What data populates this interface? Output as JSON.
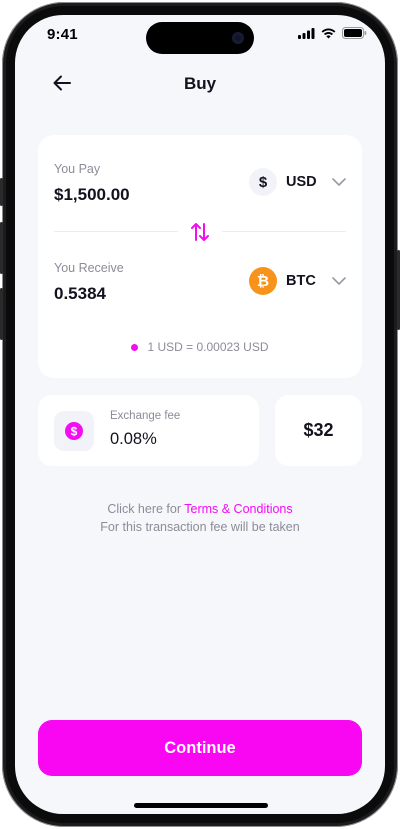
{
  "status_bar": {
    "time": "9:41"
  },
  "header": {
    "title": "Buy"
  },
  "exchange": {
    "pay": {
      "label": "You Pay",
      "amount": "$1,500.00",
      "currency_code": "USD",
      "currency_symbol": "$"
    },
    "receive": {
      "label": "You Receive",
      "amount": "0.5384",
      "currency_code": "BTC",
      "currency_symbol": "₿"
    },
    "rate": "1 USD = 0.00023 USD"
  },
  "fee": {
    "label": "Exchange fee",
    "value": "0.08%",
    "amount": "$32",
    "icon_symbol": "$"
  },
  "terms": {
    "prefix": "Click here for ",
    "link": "Terms & Conditions",
    "line2": "For this transaction fee will be taken"
  },
  "continue_label": "Continue",
  "colors": {
    "accent": "#f907f3",
    "btc": "#f7931a",
    "background": "#f6f7fb",
    "card": "#ffffff"
  },
  "icons": [
    "back-arrow-icon",
    "dollar-icon",
    "bitcoin-icon",
    "chevron-down-icon",
    "swap-arrows-icon",
    "signal-icon",
    "wifi-icon",
    "battery-icon"
  ]
}
